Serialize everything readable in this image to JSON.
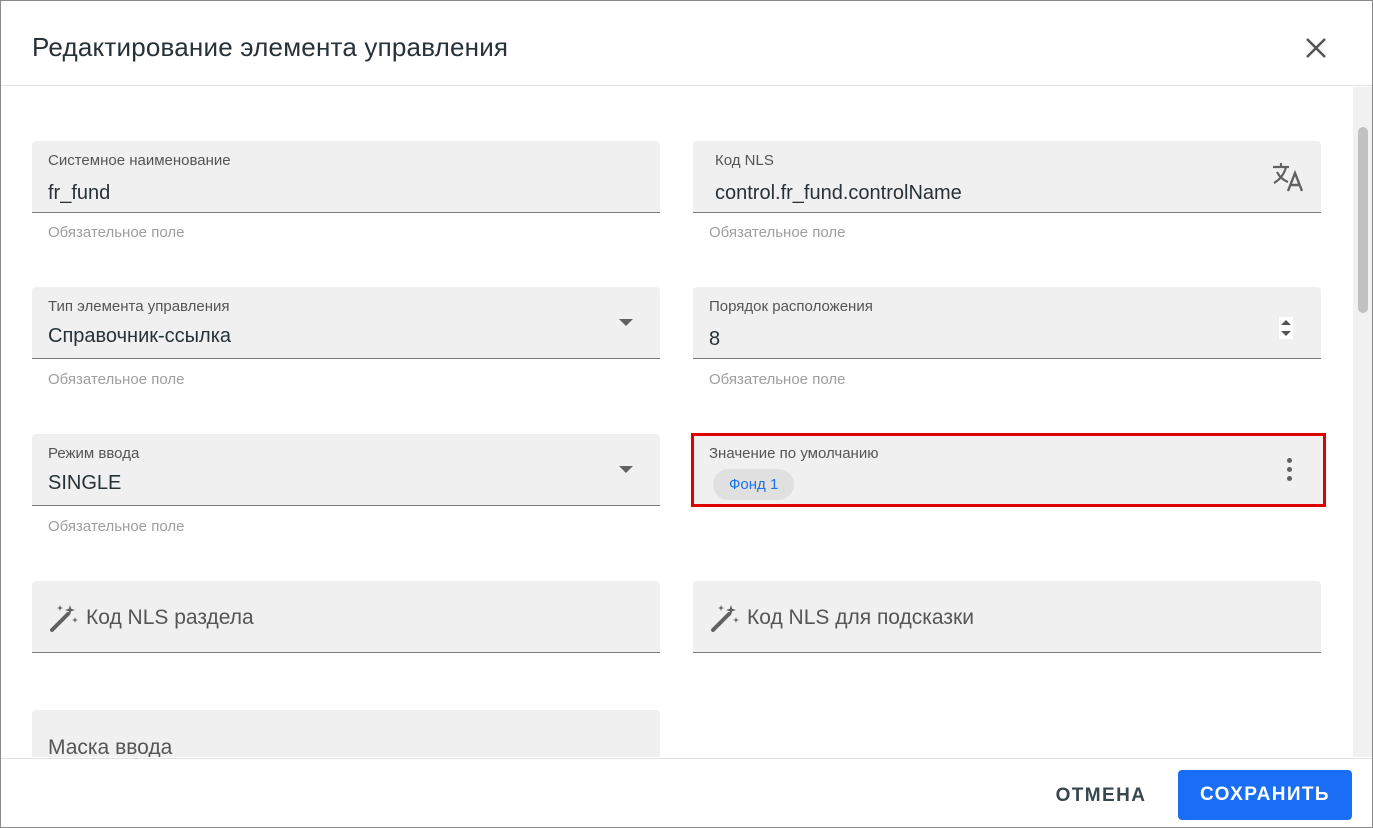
{
  "dialog": {
    "title": "Редактирование элемента управления"
  },
  "fields": {
    "system_name": {
      "label": "Системное наименование",
      "value": "fr_fund",
      "hint": "Обязательное поле"
    },
    "nls_code": {
      "label": "Код NLS",
      "value": "control.fr_fund.controlName",
      "hint": "Обязательное поле"
    },
    "control_type": {
      "label": "Тип элемента управления",
      "value": "Справочник-ссылка",
      "hint": "Обязательное поле"
    },
    "order": {
      "label": "Порядок расположения",
      "value": "8",
      "hint": "Обязательное поле"
    },
    "input_mode": {
      "label": "Режим ввода",
      "value": "SINGLE",
      "hint": "Обязательное поле"
    },
    "default_value": {
      "label": "Значение по умолчанию",
      "chip": "Фонд 1"
    },
    "section_nls": {
      "placeholder": "Код NLS раздела"
    },
    "tooltip_nls": {
      "placeholder": "Код NLS для подсказки"
    },
    "input_mask": {
      "placeholder": "Маска ввода"
    }
  },
  "footer": {
    "cancel_label": "ОТМЕНА",
    "save_label": "СОХРАНИТЬ"
  },
  "colors": {
    "primary": "#1a6ef5",
    "highlight": "#e00000",
    "chip_text": "#1a73e8"
  },
  "icons": [
    "close-icon",
    "translate-icon",
    "dropdown-arrow-icon",
    "spinner-icon",
    "kebab-menu-icon",
    "magic-wand-icon"
  ]
}
